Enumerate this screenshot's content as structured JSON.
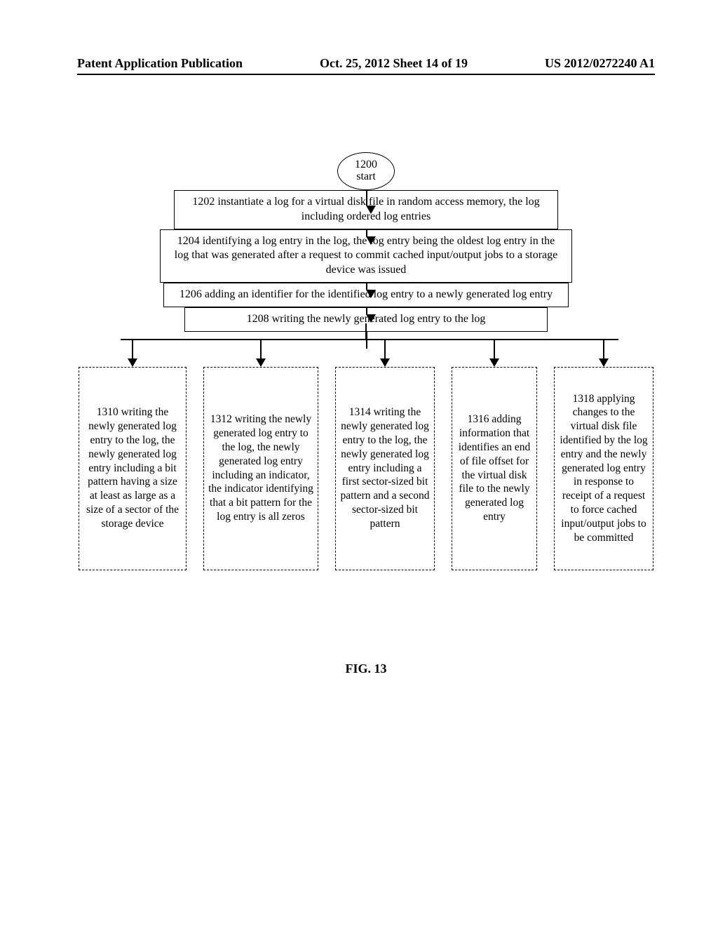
{
  "header": {
    "left": "Patent Application Publication",
    "mid": "Oct. 25, 2012  Sheet 14 of 19",
    "right": "US 2012/0272240 A1"
  },
  "start": {
    "num": "1200",
    "label": "start"
  },
  "steps": {
    "s1202": "1202 instantiate a log for a virtual disk file in random access memory, the log including ordered log entries",
    "s1204": "1204 identifying  a log entry in the log, the log entry being the oldest log entry in the log that was generated after a request to commit cached input/output jobs to a storage device was issued",
    "s1206": "1206 adding an identifier for the identified log entry to a newly generated log entry",
    "s1208": "1208 writing the newly generated log entry to the log"
  },
  "branches": {
    "b1310": "1310 writing the newly generated log entry to the log, the newly generated log entry including a bit pattern having a size at least as large as a size of a sector of the storage device",
    "b1312": "1312 writing the newly generated log entry to the log, the newly generated log entry including an indicator, the indicator identifying that a bit pattern for the log entry is all zeros",
    "b1314": "1314 writing the newly generated log entry to the log, the newly generated log entry including a first sector-sized bit pattern and a second sector-sized bit pattern",
    "b1316": "1316 adding information that identifies an end of file offset for the virtual disk file to the newly generated log entry",
    "b1318": "1318 applying changes to the virtual disk file identified by the log entry and the newly generated log entry in response to receipt of a request to force cached input/output jobs to be committed"
  },
  "figure": "FIG. 13"
}
